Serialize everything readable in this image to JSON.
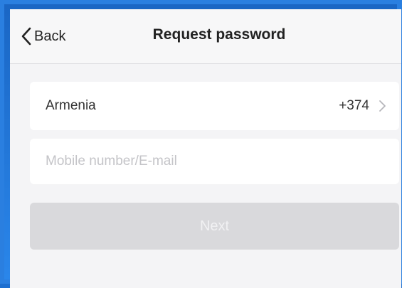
{
  "navbar": {
    "back_label": "Back",
    "back_icon": "chevron-left-icon",
    "title": "Request password"
  },
  "country_selector": {
    "country": "Armenia",
    "code": "+374",
    "icon": "chevron-right-icon"
  },
  "contact_input": {
    "value": "",
    "placeholder": "Mobile number/E-mail"
  },
  "next_button": {
    "label": "Next",
    "state": "disabled"
  }
}
